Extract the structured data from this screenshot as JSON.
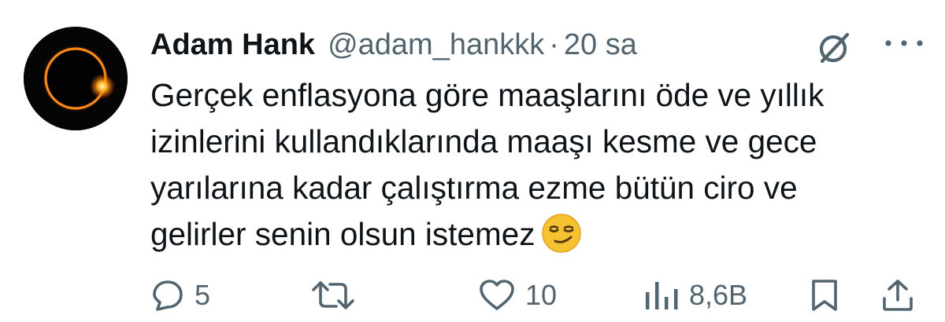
{
  "tweet": {
    "author_name": "Adam Hank",
    "handle": "@adam_hankkk",
    "separator": "·",
    "time": "20 sa",
    "lines": [
      "Gerçek enflasyona göre maaşlarını öde ve yıllık",
      "izinlerini kullandıklarında maaşı kesme ve gece",
      "yarılarına kadar çalıştırma ezme bütün ciro ve",
      "gelirler senin olsun istemez"
    ],
    "emoji": "smirking-face-emoji"
  },
  "actions": {
    "replies": "5",
    "likes": "10",
    "views": "8,6B"
  },
  "icons": {
    "avatar": "solar-eclipse-avatar",
    "grok": "grok-icon",
    "more": "more-icon",
    "reply": "reply-icon",
    "retweet": "retweet-icon",
    "like": "heart-icon",
    "views": "views-icon",
    "bookmark": "bookmark-icon",
    "share": "share-icon"
  },
  "colors": {
    "text": "#0f1419",
    "secondary": "#536471",
    "emoji_yellow": "#f7c232"
  }
}
